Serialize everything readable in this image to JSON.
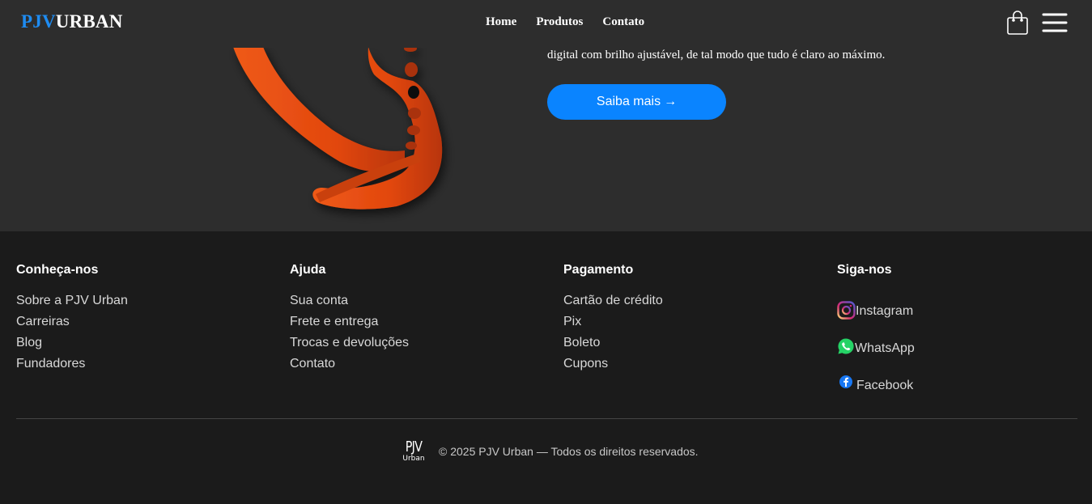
{
  "header": {
    "logo_primary": "PJV",
    "logo_secondary": "URBAN",
    "nav": [
      {
        "label": "Home"
      },
      {
        "label": "Produtos"
      },
      {
        "label": "Contato"
      }
    ],
    "icons": {
      "cart": "shopping-bag-icon",
      "menu": "hamburger-menu-icon"
    }
  },
  "hero": {
    "text": "digital com brilho ajustável, de tal modo que tudo é claro ao máximo.",
    "cta_label": "Saiba mais",
    "cta_arrow": "→",
    "accent": "#0a84ff",
    "product_color": "#e2470f"
  },
  "footer": {
    "columns": [
      {
        "title": "Conheça-nos",
        "items": [
          "Sobre a PJV Urban",
          "Carreiras",
          "Blog",
          "Fundadores"
        ]
      },
      {
        "title": "Ajuda",
        "items": [
          "Sua conta",
          "Frete e entrega",
          "Trocas e devoluções",
          "Contato"
        ]
      },
      {
        "title": "Pagamento",
        "items": [
          "Cartão de crédito",
          "Pix",
          "Boleto",
          "Cupons"
        ]
      }
    ],
    "social": {
      "title": "Siga-nos",
      "items": [
        {
          "label": "Instagram",
          "icon": "instagram-icon"
        },
        {
          "label": "WhatsApp",
          "icon": "whatsapp-icon"
        },
        {
          "label": "Facebook",
          "icon": "facebook-icon"
        }
      ]
    },
    "mini_logo_top": "PJV",
    "mini_logo_bottom": "Urban",
    "copyright": "© 2025 PJV Urban — Todos os direitos reservados."
  }
}
